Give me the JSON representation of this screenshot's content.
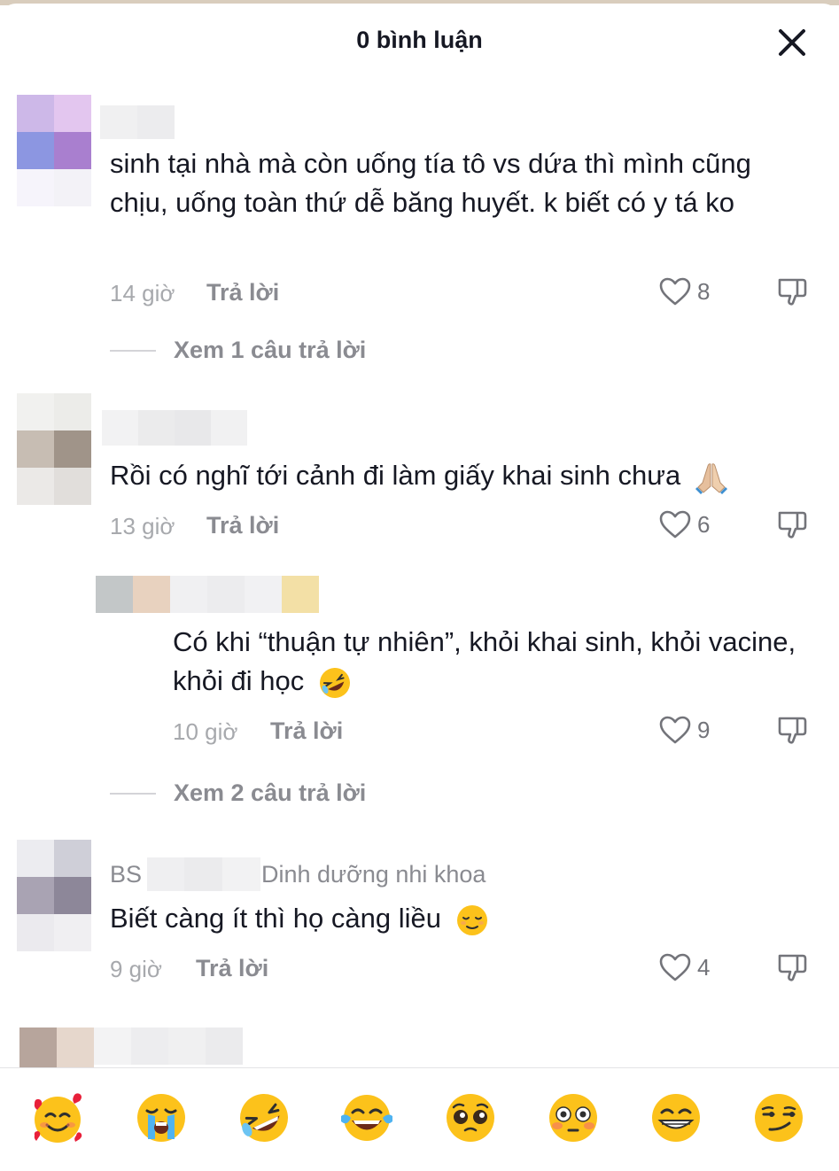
{
  "header": {
    "title": "0 bình luận"
  },
  "comments": [
    {
      "text": "sinh tại nhà mà còn uống tía tô vs dứa thì mình cũng chịu, uống toàn thứ dễ băng huyết. k biết có y tá ko",
      "time": "14 giờ",
      "reply_label": "Trả lời",
      "likes": "8",
      "view_replies": "Xem 1 câu trả lời"
    },
    {
      "text": "Rồi có nghĩ tới cảnh đi làm giấy khai sinh chưa",
      "time": "13 giờ",
      "reply_label": "Trả lời",
      "likes": "6"
    },
    {
      "text": "Có khi “thuận tự nhiên”, khỏi khai sinh, khỏi vacine, khỏi đi học",
      "time": "10 giờ",
      "reply_label": "Trả lời",
      "likes": "9",
      "view_replies": "Xem 2 câu trả lời"
    },
    {
      "username_prefix": "BS",
      "username_suffix": "Dinh dưỡng nhi khoa",
      "text": "Biết càng ít thì họ càng liều",
      "time": "9 giờ",
      "reply_label": "Trả lời",
      "likes": "4"
    }
  ],
  "emoji_bar": [
    "smiling-face-with-hearts",
    "loudly-crying-face",
    "rolling-on-floor-laughing",
    "face-with-tears-of-joy",
    "pleading-face",
    "flushed-face",
    "grinning-face",
    "smirking-face"
  ],
  "colors": {
    "text": "#161823",
    "muted": "#8a8b91",
    "meta": "#a7a9ad",
    "emoji": "#fcc21b"
  }
}
